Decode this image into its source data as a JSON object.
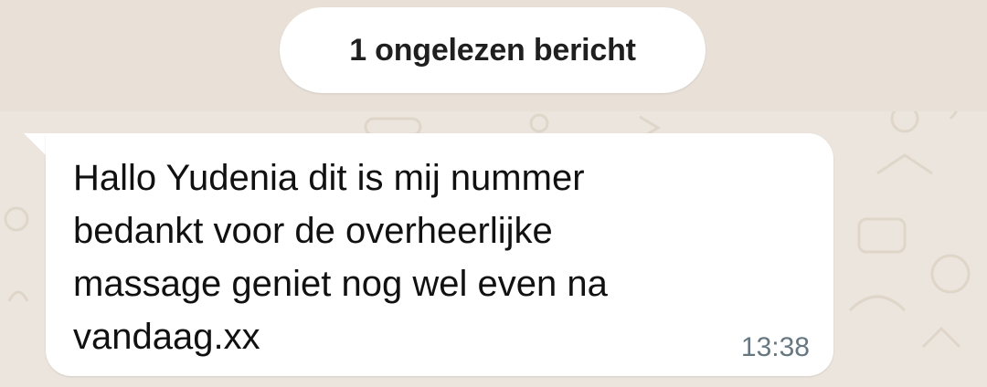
{
  "chat": {
    "unread_banner": "1 ongelezen bericht",
    "messages": [
      {
        "direction": "incoming",
        "text": "Hallo Yudenia dit is mij nummer\nbedankt voor de overheerlijke\nmassage geniet nog wel even na\nvandaag.xx",
        "time": "13:38"
      }
    ]
  },
  "colors": {
    "wallpaper": "#ece5dd",
    "bubble": "#ffffff",
    "timestamp": "#667781"
  }
}
